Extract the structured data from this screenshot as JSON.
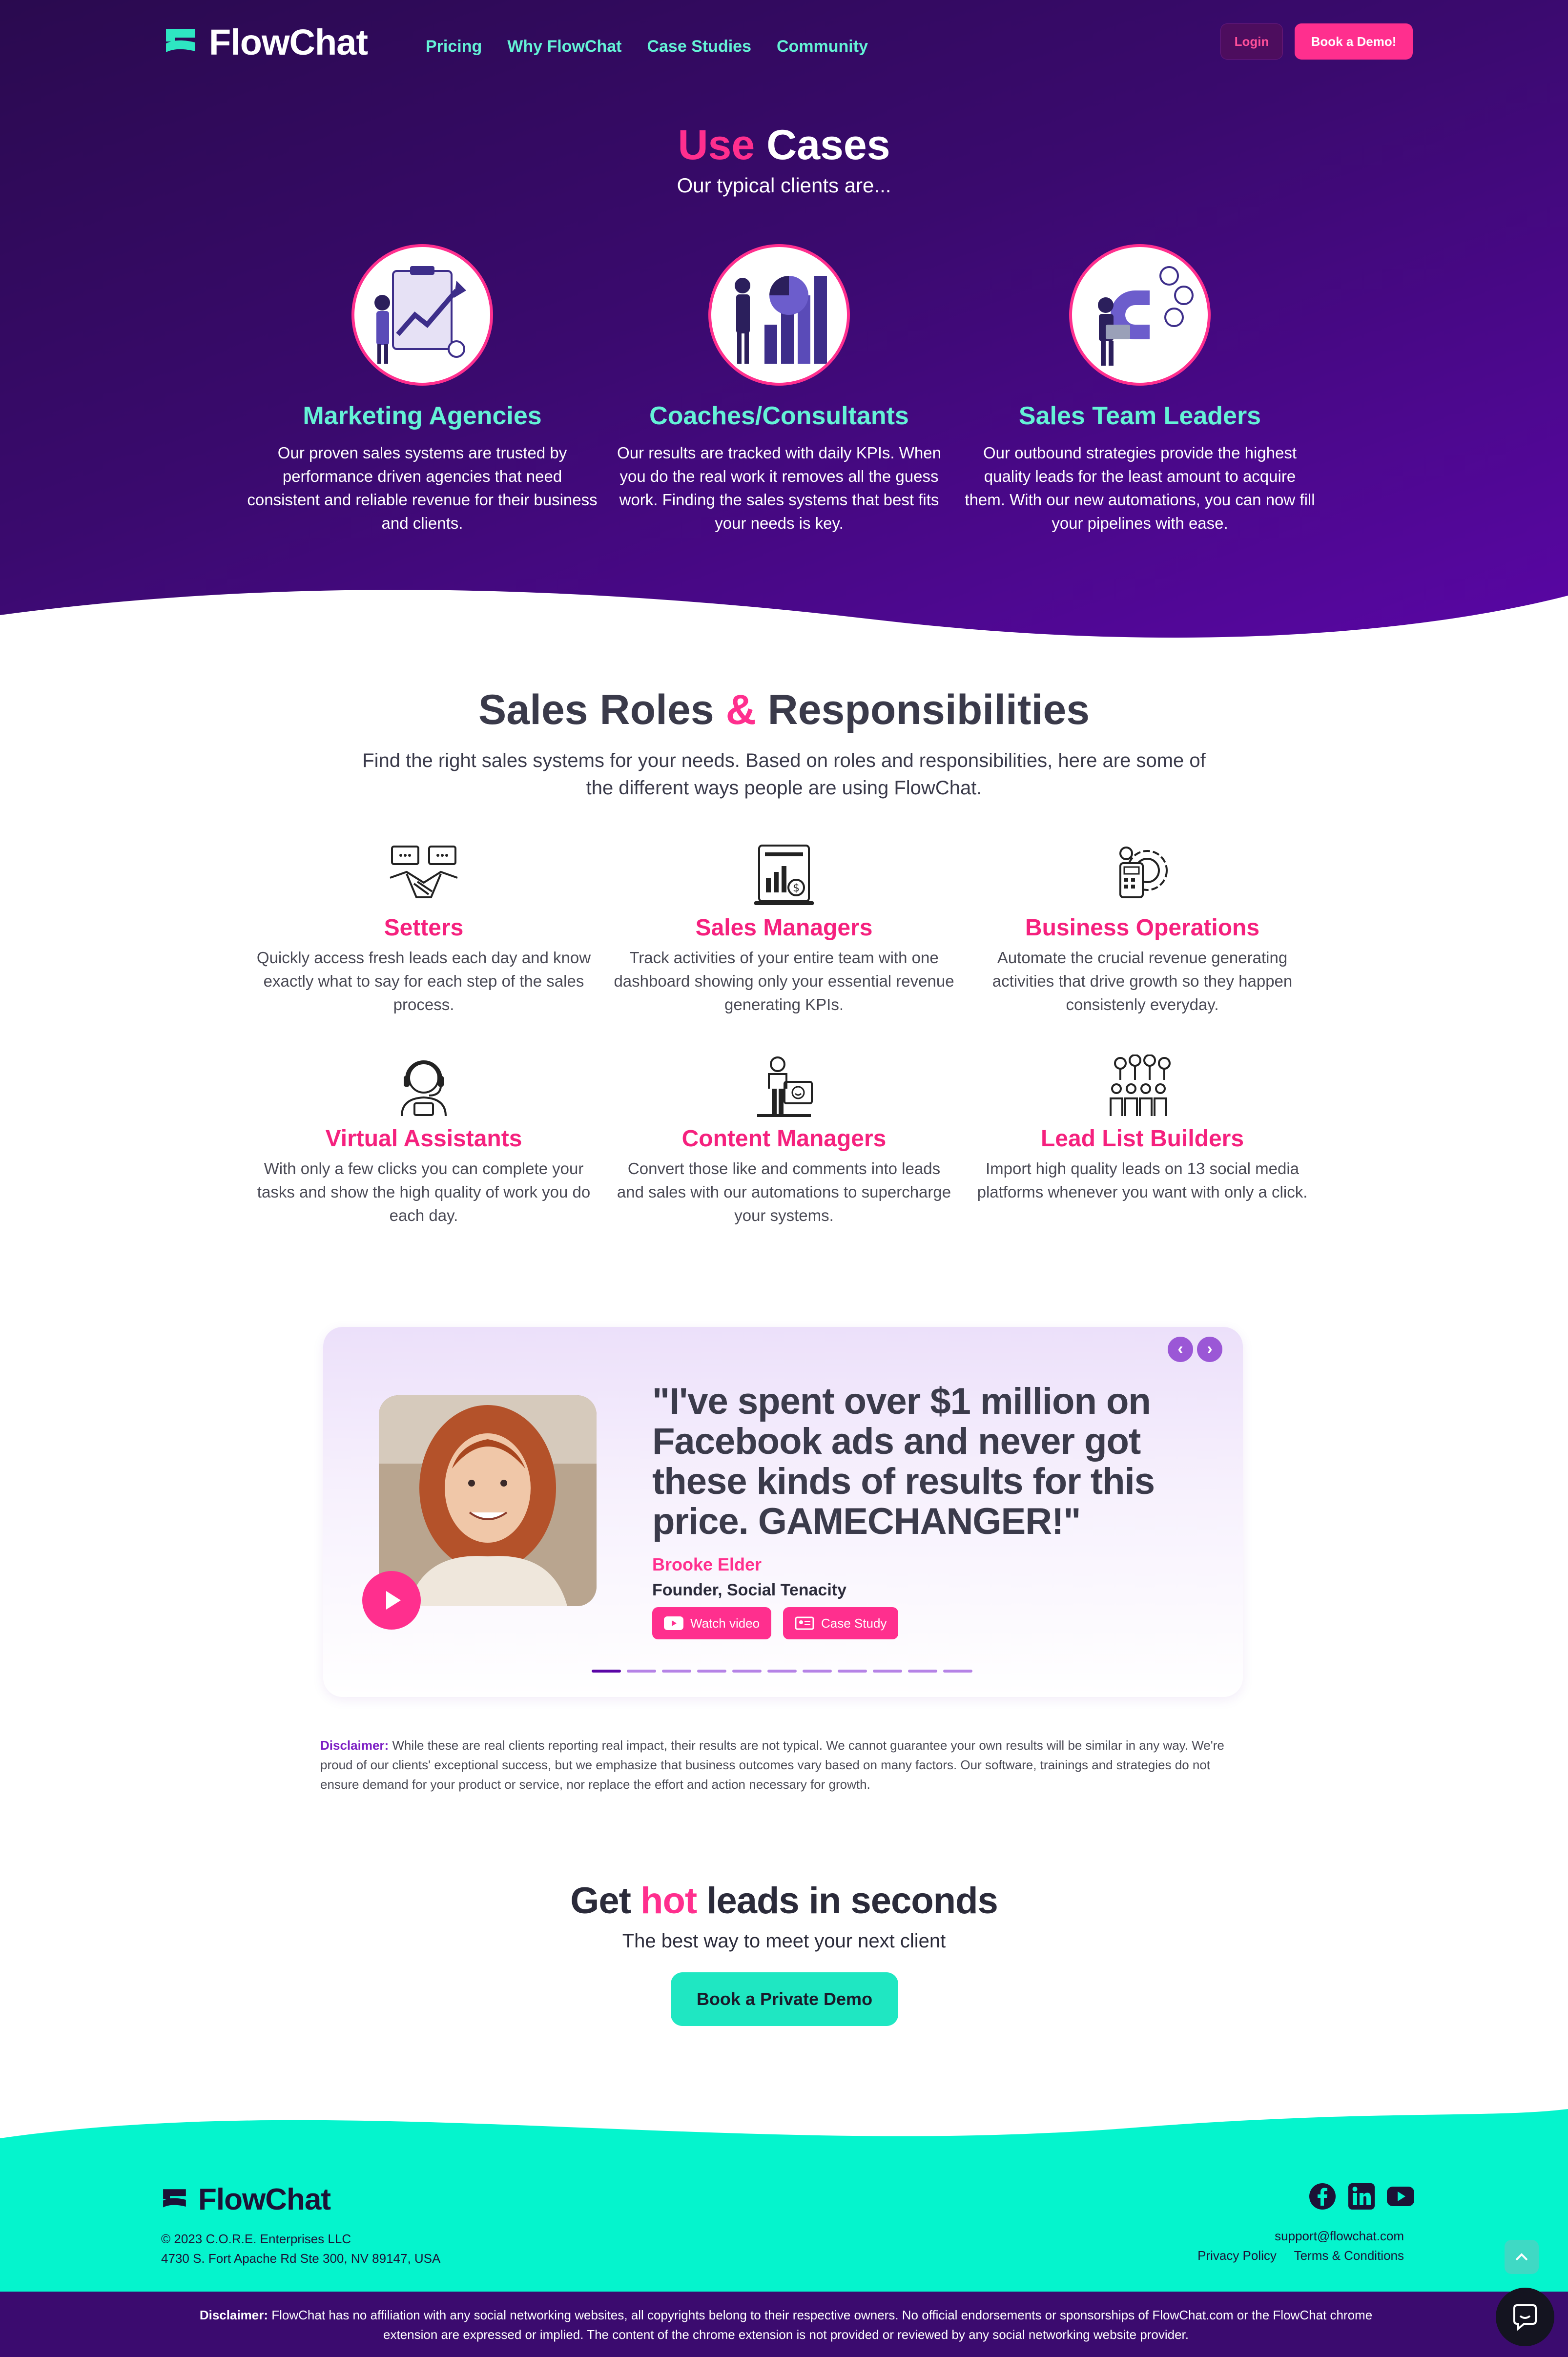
{
  "nav": {
    "logo": "FlowChat",
    "links": [
      "Pricing",
      "Why FlowChat",
      "Case Studies",
      "Community"
    ],
    "login": "Login",
    "demo": "Book a Demo!"
  },
  "use_cases": {
    "title_pink": "Use",
    "title_rest": "Cases",
    "subtitle": "Our typical clients are...",
    "items": [
      {
        "heading": "Marketing Agencies",
        "text": "Our proven sales systems are trusted by performance driven agencies that need consistent and reliable revenue for their business and clients."
      },
      {
        "heading": "Coaches/Consultants",
        "text": "Our results are tracked with daily KPIs. When you do the real work it removes all the guess work. Finding the sales systems that best fits your needs is key."
      },
      {
        "heading": "Sales Team Leaders",
        "text": "Our outbound strategies provide the highest quality leads for the least amount to acquire them. With our new automations, you can now fill your pipelines with ease."
      }
    ]
  },
  "roles": {
    "title_a": "Sales Roles",
    "title_amp": "&",
    "title_b": "Responsibilities",
    "subtitle": "Find the right sales systems for your needs. Based on roles and responsibilities, here are some of the different ways people are using FlowChat.",
    "items": [
      {
        "heading": "Setters",
        "text": "Quickly access fresh leads each day and know exactly what to say for each step of the sales process.",
        "icon": "handshake-icon"
      },
      {
        "heading": "Sales Managers",
        "text": "Track activities of your entire team with one dashboard showing only your essential revenue generating KPIs.",
        "icon": "dashboard-icon"
      },
      {
        "heading": "Business Operations",
        "text": "Automate the crucial revenue generating activities that drive growth so they happen consistenly everyday.",
        "icon": "gear-calculator-icon"
      },
      {
        "heading": "Virtual Assistants",
        "text": "With only a few clicks you can complete your tasks and show the high quality of work you do each day.",
        "icon": "headset-icon"
      },
      {
        "heading": "Content Managers",
        "text": "Convert those like and comments into leads and sales with our automations to supercharge your systems.",
        "icon": "presenter-icon"
      },
      {
        "heading": "Lead List Builders",
        "text": "Import high quality leads on 13 social media platforms whenever you want with only a click.",
        "icon": "people-pins-icon"
      }
    ]
  },
  "testimonial": {
    "quote": "\"I've spent over $1 million on Facebook ads and never got these kinds of results for this price. GAMECHANGER!\"",
    "name": "Brooke Elder",
    "role": "Founder, Social Tenacity",
    "watch": "Watch video",
    "case": "Case Study",
    "slide_count": 11,
    "active_slide": 0
  },
  "disclaimer": {
    "label": "Disclaimer:",
    "text": "While these are real clients reporting real impact, their results are not typical. We cannot guarantee your own results will be similar in any way. We're proud of our clients' exceptional success, but we emphasize that business outcomes vary based on many factors. Our software, trainings and strategies do not ensure demand for your product or service, nor replace the effort and action necessary for growth."
  },
  "cta": {
    "title_a": "Get",
    "title_hot": "hot",
    "title_b": "leads in seconds",
    "subtitle": "The best way to meet your next client",
    "button": "Book a Private Demo"
  },
  "footer": {
    "logo": "FlowChat",
    "copyright": "© 2023 C.O.R.E. Enterprises LLC",
    "address": "4730 S. Fort Apache Rd Ste 300, NV 89147, USA",
    "email": "support@flowchat.com",
    "privacy": "Privacy Policy",
    "terms": "Terms & Conditions",
    "bottom_label": "Disclaimer:",
    "bottom_text": "FlowChat has no affiliation with any social networking websites, all copyrights belong to their respective owners. No official endorsements or sponsorships of FlowChat.com or the FlowChat chrome extension are expressed or implied. The content of the chrome extension is not provided or reviewed by any social networking website provider."
  },
  "colors": {
    "pink": "#ff2f8e",
    "mint": "#64f2d6",
    "purple": "#3a0a6e",
    "teal": "#1fe7c2"
  }
}
